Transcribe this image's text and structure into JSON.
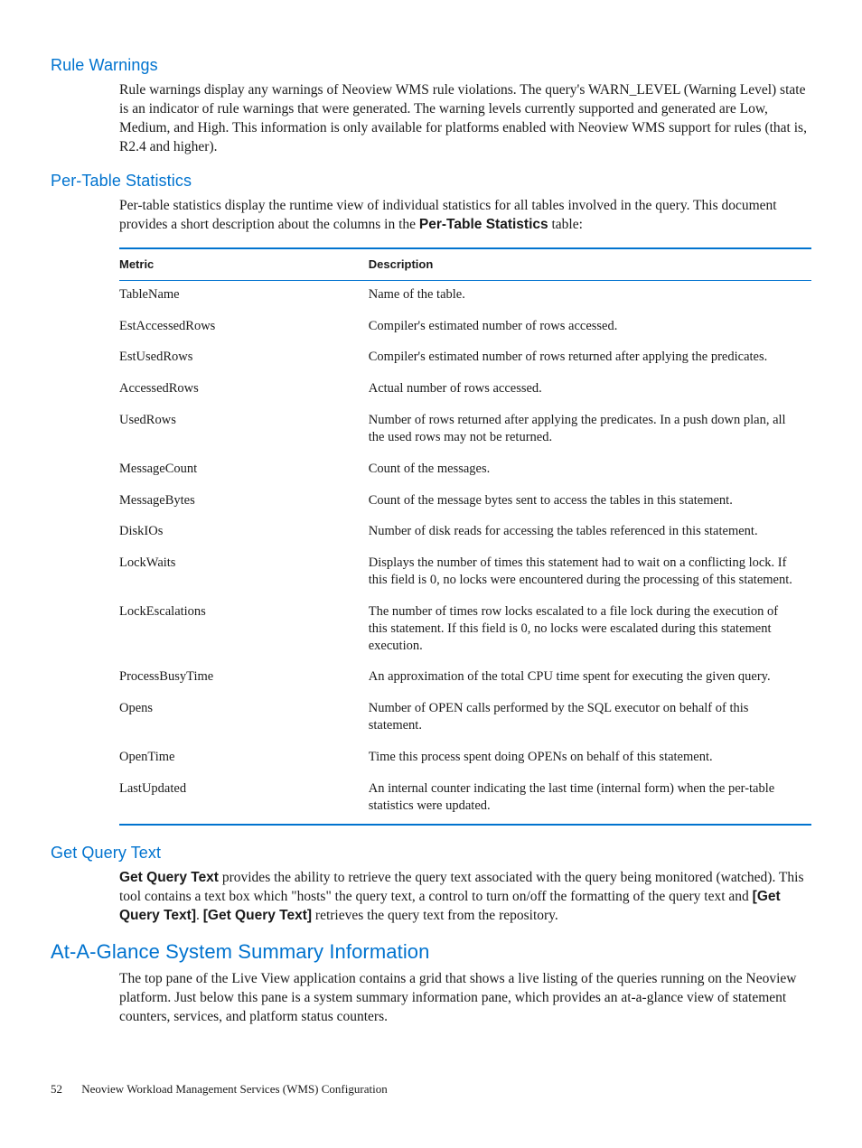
{
  "sections": {
    "ruleWarnings": {
      "heading": "Rule Warnings",
      "body": "Rule warnings display any warnings of Neoview WMS rule violations. The query's WARN_LEVEL (Warning Level) state is an indicator of rule warnings that were generated. The warning levels currently supported and generated are Low, Medium, and High. This information is only available for platforms enabled with Neoview WMS support for rules (that is, R2.4 and higher)."
    },
    "perTableStats": {
      "heading": "Per-Table Statistics",
      "intro_pre": "Per-table statistics display the runtime view of individual statistics for all tables involved in the query. This document provides a short description about the columns in the ",
      "intro_bold": "Per-Table Statistics",
      "intro_post": " table:",
      "tableHeaders": {
        "metric": "Metric",
        "description": "Description"
      },
      "rows": [
        {
          "metric": "TableName",
          "description": "Name of the table."
        },
        {
          "metric": "EstAccessedRows",
          "description": "Compiler's estimated number of rows accessed."
        },
        {
          "metric": "EstUsedRows",
          "description": "Compiler's estimated number of rows returned after applying the predicates."
        },
        {
          "metric": "AccessedRows",
          "description": "Actual number of rows accessed."
        },
        {
          "metric": "UsedRows",
          "description": "Number of rows returned after applying the predicates. In a push down plan, all the used rows may not be returned."
        },
        {
          "metric": "MessageCount",
          "description": "Count of the messages."
        },
        {
          "metric": "MessageBytes",
          "description": "Count of the message bytes sent to access the tables in this statement."
        },
        {
          "metric": "DiskIOs",
          "description": "Number of disk reads for accessing the tables referenced in this statement."
        },
        {
          "metric": "LockWaits",
          "description": "Displays the number of times this statement had to wait on a conflicting lock. If this field is 0, no locks were encountered during the processing of this statement."
        },
        {
          "metric": "LockEscalations",
          "description": "The number of times row locks escalated to a file lock during the execution of this statement. If this field is 0, no locks were escalated during this statement execution."
        },
        {
          "metric": "ProcessBusyTime",
          "description": "An approximation of the total CPU time spent for executing the given query."
        },
        {
          "metric": "Opens",
          "description": "Number of OPEN calls performed by the SQL executor on behalf of this statement."
        },
        {
          "metric": "OpenTime",
          "description": "Time this process spent doing OPENs on behalf of this statement."
        },
        {
          "metric": "LastUpdated",
          "description": "An internal counter indicating the last time (internal form) when the per-table statistics were updated."
        }
      ]
    },
    "getQueryText": {
      "heading": "Get Query Text",
      "lead_bold": "Get Query Text",
      "body_part1": " provides the ability to retrieve the query text associated with the query being monitored (watched). This tool contains a text box which \"hosts\" the query text, a control to turn on/off the formatting of the query text and ",
      "btn1": "[Get Query Text]",
      "sep": ". ",
      "btn2": "[Get Query Text]",
      "body_part2": " retrieves the query text from the repository."
    },
    "atAGlance": {
      "heading": "At-A-Glance System Summary Information",
      "body": "The top pane of the Live View application contains a grid that shows a live listing of the queries running on the Neoview platform. Just below this pane is a system summary information pane, which provides an at-a-glance view of statement counters, services, and platform status counters."
    }
  },
  "footer": {
    "pageNumber": "52",
    "title": "Neoview Workload Management Services (WMS) Configuration"
  }
}
